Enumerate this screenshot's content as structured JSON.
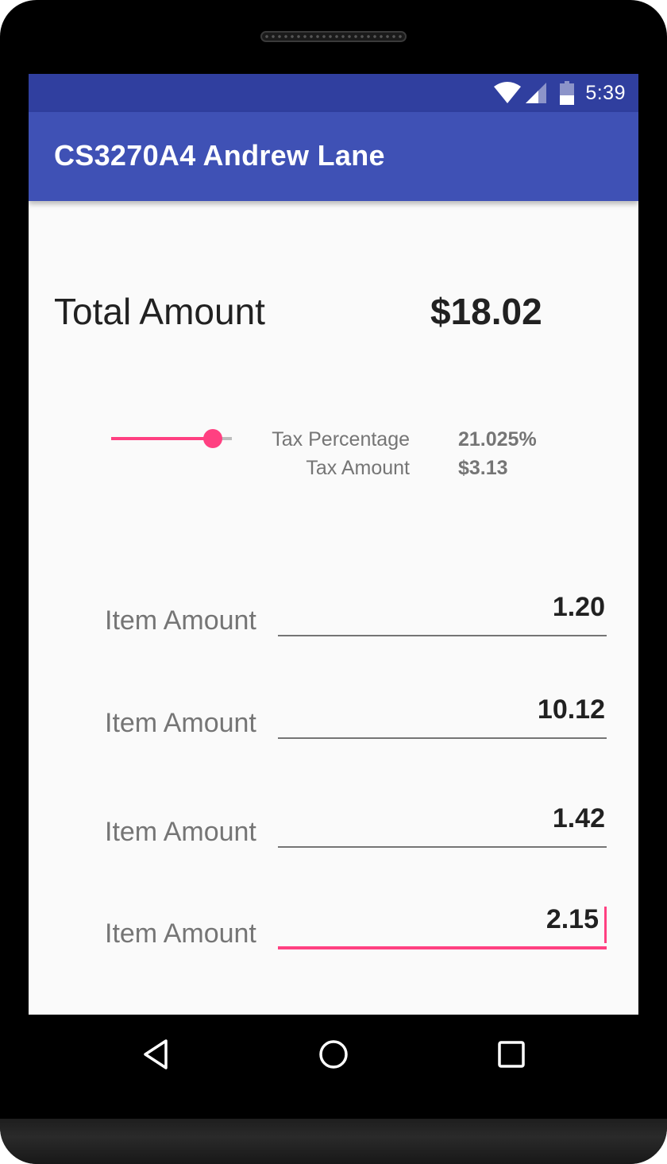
{
  "status_bar": {
    "time": "5:39",
    "icons": [
      "wifi-icon",
      "cell-signal-icon",
      "battery-icon"
    ]
  },
  "app_bar": {
    "title": "CS3270A4 Andrew Lane",
    "color": "#3f51b5",
    "status_color": "#303f9f"
  },
  "total": {
    "label": "Total Amount",
    "value": "$18.02"
  },
  "tax": {
    "slider_fraction": 0.84,
    "percentage_label": "Tax Percentage",
    "percentage_value": "21.025%",
    "amount_label": "Tax Amount",
    "amount_value": "$3.13"
  },
  "items": [
    {
      "label": "Item Amount",
      "value": "1.20"
    },
    {
      "label": "Item Amount",
      "value": "10.12"
    },
    {
      "label": "Item Amount",
      "value": "1.42"
    },
    {
      "label": "Item Amount",
      "value": "2.15"
    }
  ],
  "accent_color": "#ff4081",
  "nav_icons": [
    "back-icon",
    "home-icon",
    "recents-icon"
  ]
}
